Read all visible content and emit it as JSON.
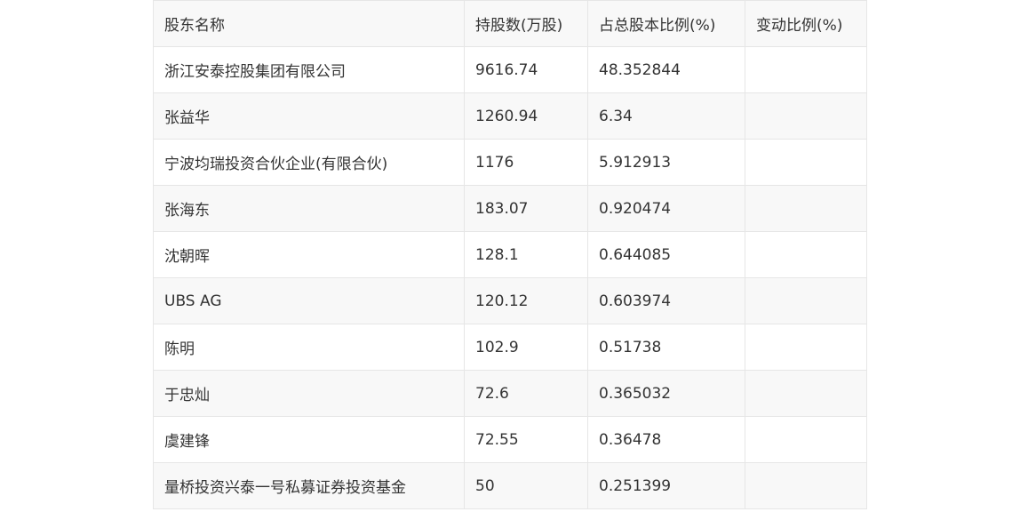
{
  "table": {
    "headers": [
      "股东名称",
      "持股数(万股)",
      "占总股本比例(%)",
      "变动比例(%)"
    ],
    "rows": [
      [
        "浙江安泰控股集团有限公司",
        "9616.74",
        "48.352844",
        ""
      ],
      [
        "张益华",
        "1260.94",
        "6.34",
        ""
      ],
      [
        "宁波均瑞投资合伙企业(有限合伙)",
        "1176",
        "5.912913",
        ""
      ],
      [
        "张海东",
        "183.07",
        "0.920474",
        ""
      ],
      [
        "沈朝晖",
        "128.1",
        "0.644085",
        ""
      ],
      [
        "UBS AG",
        "120.12",
        "0.603974",
        ""
      ],
      [
        "陈明",
        "102.9",
        "0.51738",
        ""
      ],
      [
        "于忠灿",
        "72.6",
        "0.365032",
        ""
      ],
      [
        "虞建锋",
        "72.55",
        "0.36478",
        ""
      ],
      [
        "量桥投资兴泰一号私募证券投资基金",
        "50",
        "0.251399",
        ""
      ]
    ]
  }
}
